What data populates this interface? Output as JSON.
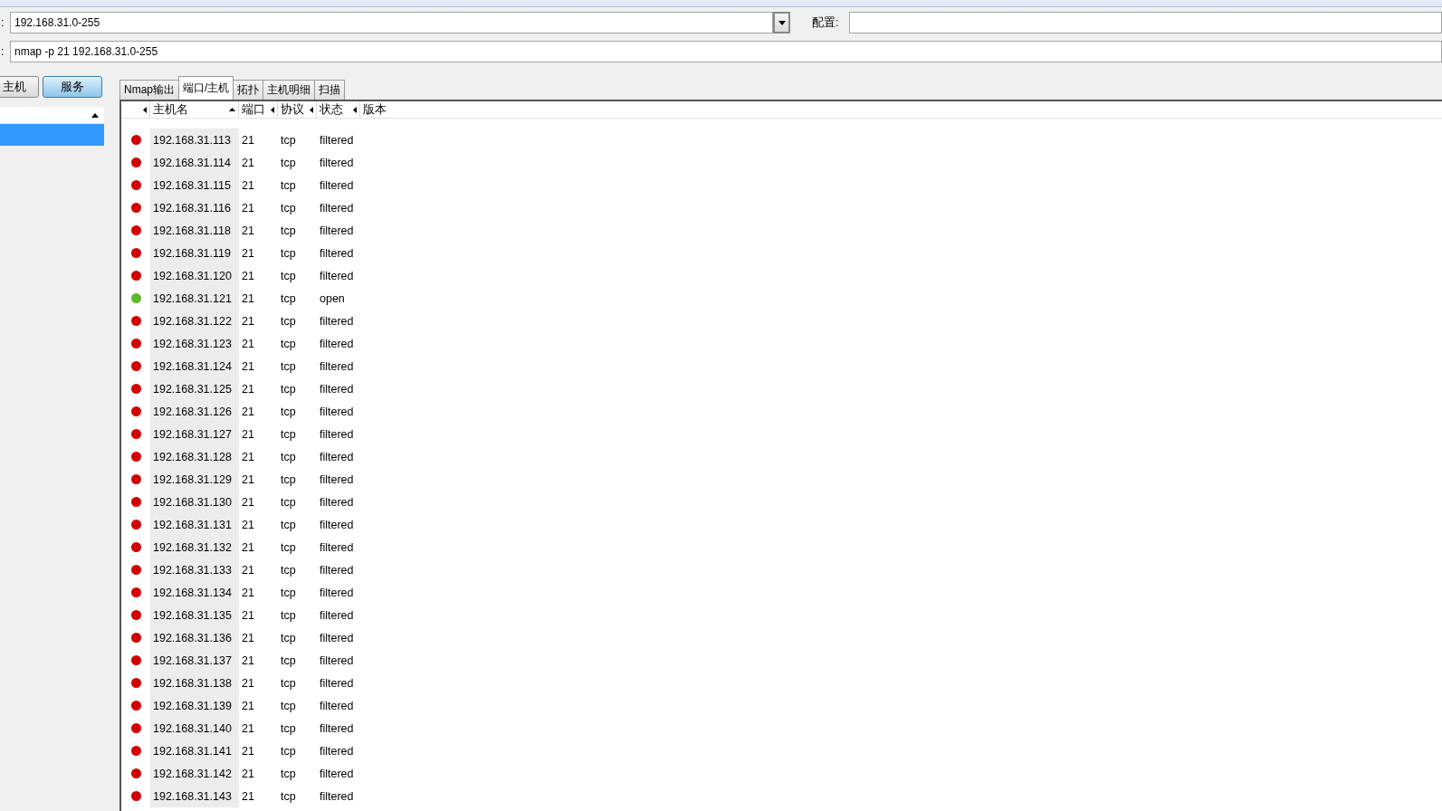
{
  "target": {
    "label": ":",
    "value": "192.168.31.0-255"
  },
  "profile": {
    "label": "配置:"
  },
  "command": {
    "label": ":",
    "value": "nmap -p 21 192.168.31.0-255"
  },
  "view_buttons": [
    {
      "label": "主机",
      "selected": false
    },
    {
      "label": "服务",
      "selected": true
    }
  ],
  "tabs": [
    {
      "label": "Nmap输出",
      "selected": false
    },
    {
      "label": "端口/主机",
      "selected": true
    },
    {
      "label": "拓扑",
      "selected": false
    },
    {
      "label": "主机明细",
      "selected": false
    },
    {
      "label": "扫描",
      "selected": false
    }
  ],
  "columns": [
    "主机名",
    "端口",
    "协议",
    "状态",
    "版本"
  ],
  "rows": [
    {
      "host": "192.168.31.113",
      "port": "21",
      "protocol": "tcp",
      "state": "filtered",
      "color": "#d40000"
    },
    {
      "host": "192.168.31.114",
      "port": "21",
      "protocol": "tcp",
      "state": "filtered",
      "color": "#d40000"
    },
    {
      "host": "192.168.31.115",
      "port": "21",
      "protocol": "tcp",
      "state": "filtered",
      "color": "#d40000"
    },
    {
      "host": "192.168.31.116",
      "port": "21",
      "protocol": "tcp",
      "state": "filtered",
      "color": "#d40000"
    },
    {
      "host": "192.168.31.118",
      "port": "21",
      "protocol": "tcp",
      "state": "filtered",
      "color": "#d40000"
    },
    {
      "host": "192.168.31.119",
      "port": "21",
      "protocol": "tcp",
      "state": "filtered",
      "color": "#d40000"
    },
    {
      "host": "192.168.31.120",
      "port": "21",
      "protocol": "tcp",
      "state": "filtered",
      "color": "#d40000"
    },
    {
      "host": "192.168.31.121",
      "port": "21",
      "protocol": "tcp",
      "state": "open",
      "color": "#5cb82a"
    },
    {
      "host": "192.168.31.122",
      "port": "21",
      "protocol": "tcp",
      "state": "filtered",
      "color": "#d40000"
    },
    {
      "host": "192.168.31.123",
      "port": "21",
      "protocol": "tcp",
      "state": "filtered",
      "color": "#d40000"
    },
    {
      "host": "192.168.31.124",
      "port": "21",
      "protocol": "tcp",
      "state": "filtered",
      "color": "#d40000"
    },
    {
      "host": "192.168.31.125",
      "port": "21",
      "protocol": "tcp",
      "state": "filtered",
      "color": "#d40000"
    },
    {
      "host": "192.168.31.126",
      "port": "21",
      "protocol": "tcp",
      "state": "filtered",
      "color": "#d40000"
    },
    {
      "host": "192.168.31.127",
      "port": "21",
      "protocol": "tcp",
      "state": "filtered",
      "color": "#d40000"
    },
    {
      "host": "192.168.31.128",
      "port": "21",
      "protocol": "tcp",
      "state": "filtered",
      "color": "#d40000"
    },
    {
      "host": "192.168.31.129",
      "port": "21",
      "protocol": "tcp",
      "state": "filtered",
      "color": "#d40000"
    },
    {
      "host": "192.168.31.130",
      "port": "21",
      "protocol": "tcp",
      "state": "filtered",
      "color": "#d40000"
    },
    {
      "host": "192.168.31.131",
      "port": "21",
      "protocol": "tcp",
      "state": "filtered",
      "color": "#d40000"
    },
    {
      "host": "192.168.31.132",
      "port": "21",
      "protocol": "tcp",
      "state": "filtered",
      "color": "#d40000"
    },
    {
      "host": "192.168.31.133",
      "port": "21",
      "protocol": "tcp",
      "state": "filtered",
      "color": "#d40000"
    },
    {
      "host": "192.168.31.134",
      "port": "21",
      "protocol": "tcp",
      "state": "filtered",
      "color": "#d40000"
    },
    {
      "host": "192.168.31.135",
      "port": "21",
      "protocol": "tcp",
      "state": "filtered",
      "color": "#d40000"
    },
    {
      "host": "192.168.31.136",
      "port": "21",
      "protocol": "tcp",
      "state": "filtered",
      "color": "#d40000"
    },
    {
      "host": "192.168.31.137",
      "port": "21",
      "protocol": "tcp",
      "state": "filtered",
      "color": "#d40000"
    },
    {
      "host": "192.168.31.138",
      "port": "21",
      "protocol": "tcp",
      "state": "filtered",
      "color": "#d40000"
    },
    {
      "host": "192.168.31.139",
      "port": "21",
      "protocol": "tcp",
      "state": "filtered",
      "color": "#d40000"
    },
    {
      "host": "192.168.31.140",
      "port": "21",
      "protocol": "tcp",
      "state": "filtered",
      "color": "#d40000"
    },
    {
      "host": "192.168.31.141",
      "port": "21",
      "protocol": "tcp",
      "state": "filtered",
      "color": "#d40000"
    },
    {
      "host": "192.168.31.142",
      "port": "21",
      "protocol": "tcp",
      "state": "filtered",
      "color": "#d40000"
    },
    {
      "host": "192.168.31.143",
      "port": "21",
      "protocol": "tcp",
      "state": "filtered",
      "color": "#d40000"
    }
  ]
}
